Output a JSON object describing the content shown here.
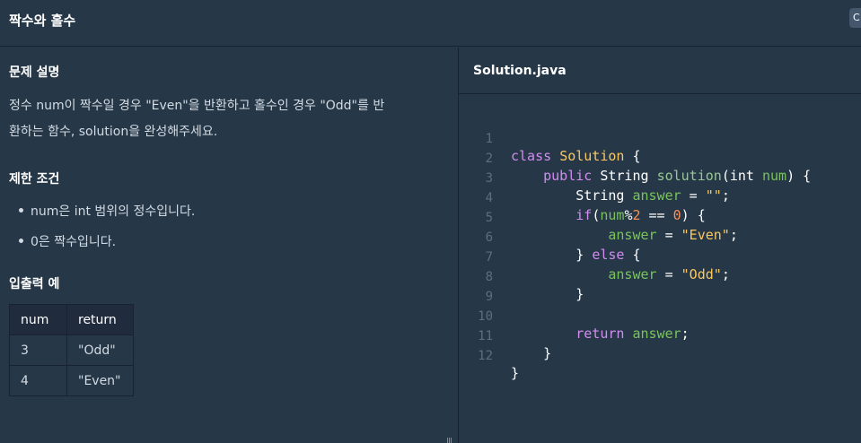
{
  "header": {
    "title": "짝수와 홀수",
    "corner_button": "C"
  },
  "problem": {
    "description_title": "문제 설명",
    "description_line1": "정수 num이 짝수일 경우 \"Even\"을 반환하고 홀수인 경우 \"Odd\"를 반",
    "description_line2": "환하는 함수, solution을 완성해주세요.",
    "constraints_title": "제한 조건",
    "constraints": [
      "num은 int 범위의 정수입니다.",
      "0은 짝수입니다."
    ],
    "examples_title": "입출력 예",
    "table": {
      "headers": [
        "num",
        "return"
      ],
      "rows": [
        [
          "3",
          "\"Odd\""
        ],
        [
          "4",
          "\"Even\""
        ]
      ]
    }
  },
  "editor": {
    "filename": "Solution.java",
    "line_numbers": [
      "1",
      "2",
      "3",
      "4",
      "5",
      "6",
      "7",
      "8",
      "9",
      "10",
      "11",
      "12"
    ],
    "tokens": {
      "class_kw": "class",
      "class_name": "Solution",
      "open_brace": " {",
      "public_kw": "public",
      "string_type": "String",
      "method_name": "solution",
      "params_open": "(",
      "int_kw": "int",
      "param_name": "num",
      "params_close": ") {",
      "string_type2": "String",
      "answer_var": "answer",
      "assign": " = ",
      "empty_str": "\"\"",
      "semi": ";",
      "if_kw": "if",
      "if_open": "(",
      "num_var": "num",
      "mod": "%",
      "two": "2",
      "eq": " == ",
      "zero": "0",
      "if_close": ") {",
      "answer_var2": "answer",
      "assign2": " = ",
      "even_str": "\"Even\"",
      "semi2": ";",
      "close_else": "} ",
      "else_kw": "else",
      "else_brace": " {",
      "answer_var3": "answer",
      "assign3": " = ",
      "odd_str": "\"Odd\"",
      "semi3": ";",
      "close_brace1": "}",
      "return_kw": "return",
      "answer_var4": "answer",
      "semi4": ";",
      "close_brace2": "}",
      "close_brace3": "}"
    }
  }
}
